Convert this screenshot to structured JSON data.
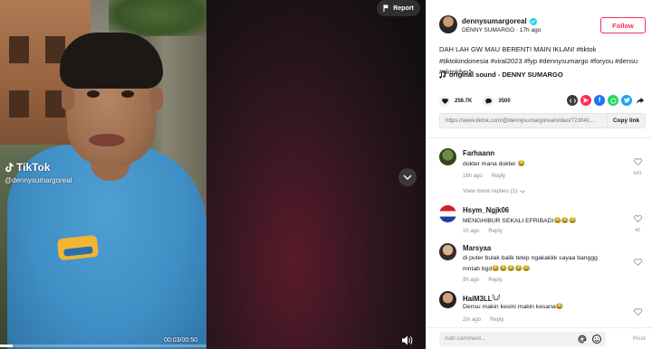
{
  "video": {
    "report_label": "Report",
    "tiktok_logo_text": "TikTok",
    "watermark_user": "@dennysumargoreal",
    "time_display": "00:03/00:50",
    "progress": 0.06
  },
  "author": {
    "username": "dennysumargoreal",
    "display_name": "DENNY SUMARGO",
    "posted": "17h ago",
    "separator": "·",
    "follow_label": "Follow"
  },
  "description": "DAH LAH GW MAU BERENTI MAIN IKLAN! #tiktok #tiktokindonesia #viral2023 #fyp #dennysumargo #foryou #densu #tiktokfyp⊱",
  "sound": "original sound - DENNY SUMARGO",
  "stats": {
    "likes": "256.7K",
    "comments": "3500"
  },
  "share": {
    "link": "https://www.tiktok.com/@dennysumargoreal/video/723041...",
    "copy_label": "Copy link"
  },
  "comments": [
    {
      "name": "Farhaann",
      "text": "dokter mana dokter 😂",
      "time": "16h ago",
      "reply": "Reply",
      "likes": "641"
    },
    {
      "name": "Hsym_Ngjk06",
      "text": "MENGHIBUR SEKALI EFRIBADI😂😂😂",
      "time": "1h ago",
      "reply": "Reply",
      "likes": "42"
    },
    {
      "name": "Marsyaa",
      "text": "di puter bulak balik tetep ngakakkk sayaa banggg",
      "text2": "mntab bgd😂😂😂😂😂",
      "time": "9h ago",
      "reply": "Reply",
      "likes": ""
    },
    {
      "name": "HaiM3LL𓆩𓆪",
      "text": "Densu makin kesini makin kesana😂",
      "time": "2m ago",
      "reply": "Reply",
      "likes": ""
    }
  ],
  "view_more": "View more replies (1)",
  "add_comment": {
    "placeholder": "Add comment...",
    "post_label": "Post"
  },
  "colors": {
    "accent": "#fe2c55",
    "verified": "#20d5ec",
    "facebook": "#1877f2",
    "whatsapp": "#25d366",
    "twitter": "#1da1f2"
  },
  "icons": {
    "report": "flag-icon",
    "like": "heart-icon",
    "comment": "comment-icon",
    "sound": "music-note-icon",
    "volume": "speaker-icon",
    "next": "chevron-down-icon"
  }
}
